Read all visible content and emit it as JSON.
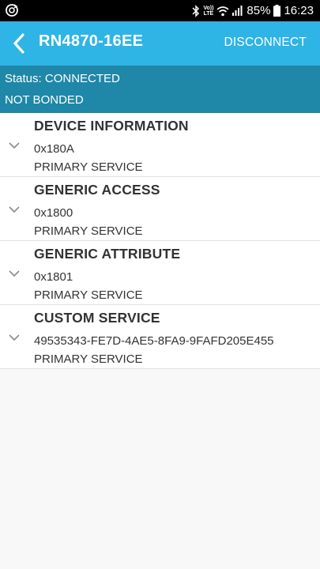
{
  "status_bar": {
    "left_icon": "sync-icon",
    "icons": [
      "bluetooth-icon",
      "volte-icon",
      "wifi-icon",
      "signal-icon",
      "battery-icon"
    ],
    "volte_line1": "Vo))",
    "volte_line2": "LTE",
    "battery": "85%",
    "time": "16:23"
  },
  "app_bar": {
    "back_icon": "back-arrow-icon",
    "title": "RN4870-16EE",
    "action": "DISCONNECT",
    "color": "#2fb4e6"
  },
  "status_band": {
    "status": "Status: CONNECTED",
    "bond": "NOT BONDED",
    "color": "#1f87a8"
  },
  "services": [
    {
      "name": "DEVICE INFORMATION",
      "uuid": "0x180A",
      "type": "PRIMARY SERVICE"
    },
    {
      "name": "GENERIC ACCESS",
      "uuid": "0x1800",
      "type": "PRIMARY SERVICE"
    },
    {
      "name": "GENERIC ATTRIBUTE",
      "uuid": "0x1801",
      "type": "PRIMARY SERVICE"
    },
    {
      "name": "CUSTOM SERVICE",
      "uuid": "49535343-FE7D-4AE5-8FA9-9FAFD205E455",
      "type": "PRIMARY SERVICE"
    }
  ]
}
